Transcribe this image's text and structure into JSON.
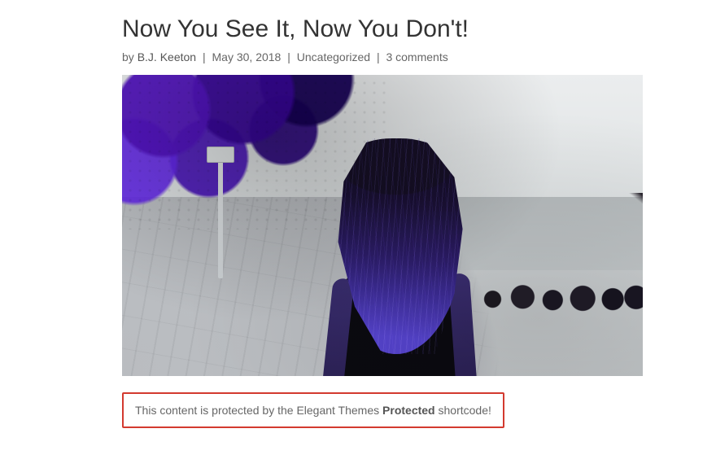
{
  "post": {
    "title": "Now You See It, Now You Don't!",
    "meta": {
      "by": "by",
      "author": "B.J. Keeton",
      "sep": "|",
      "date": "May 30, 2018",
      "category": "Uncategorized",
      "comments": "3 comments"
    }
  },
  "protected": {
    "prefix": "This content is protected by the Elegant Themes ",
    "bold": "Protected",
    "suffix": " shortcode!"
  }
}
